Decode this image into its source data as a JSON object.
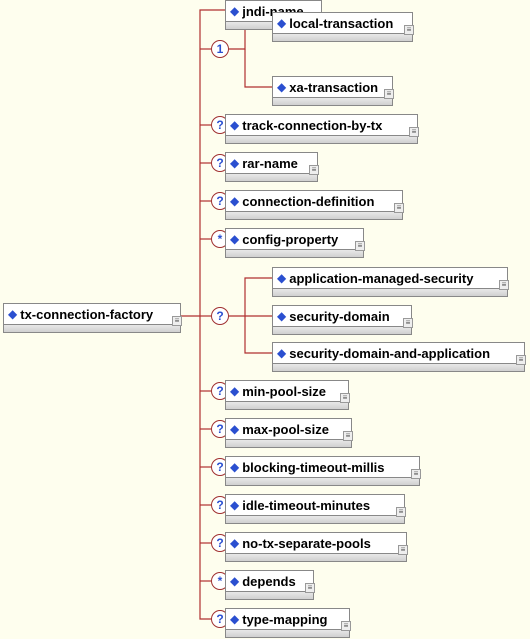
{
  "root": {
    "label": "tx-connection-factory"
  },
  "children": {
    "jndi": "jndi-name",
    "tx1": "local-transaction",
    "tx2": "xa-transaction",
    "track": "track-connection-by-tx",
    "rar": "rar-name",
    "conndef": "connection-definition",
    "cfg": "config-property",
    "sec1": "application-managed-security",
    "sec2": "security-domain",
    "sec3": "security-domain-and-application",
    "minp": "min-pool-size",
    "maxp": "max-pool-size",
    "blk": "blocking-timeout-millis",
    "idle": "idle-timeout-minutes",
    "notx": "no-tx-separate-pools",
    "dep": "depends",
    "tmap": "type-mapping"
  },
  "occ": {
    "one": "1",
    "opt": "?",
    "many": "*"
  }
}
